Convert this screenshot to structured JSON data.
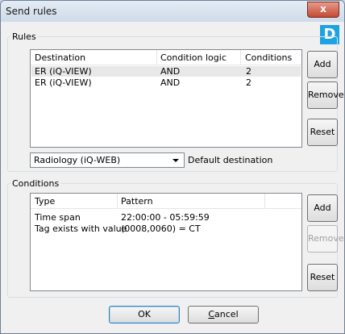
{
  "window": {
    "title": "Send rules",
    "close_glyph": "x"
  },
  "badge": "D",
  "rules": {
    "label": "Rules",
    "columns": [
      "Destination",
      "Condition logic",
      "Conditions"
    ],
    "rows": [
      [
        "ER (iQ-VIEW)",
        "AND",
        "2"
      ],
      [
        "ER (iQ-VIEW)",
        "AND",
        "2"
      ]
    ],
    "buttons": {
      "add": "Add",
      "remove": "Remove",
      "reset": "Reset"
    }
  },
  "default_destination": {
    "value": "Radiology (iQ-WEB)",
    "label": "Default destination"
  },
  "conditions": {
    "label": "Conditions",
    "columns": [
      "Type",
      "Pattern"
    ],
    "rows": [
      [
        "Time span",
        "22:00:00 - 05:59:59"
      ],
      [
        "Tag exists with value",
        "(0008,0060) = CT"
      ]
    ],
    "buttons": {
      "add": "Add",
      "remove": "Remove",
      "reset": "Reset"
    }
  },
  "dialog_buttons": {
    "ok": "OK",
    "cancel_first": "C",
    "cancel_rest": "ancel"
  }
}
